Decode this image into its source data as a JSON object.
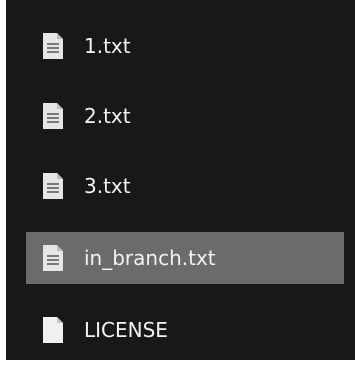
{
  "file_list": {
    "items": [
      {
        "name": "1.txt",
        "icon": "text-file-icon",
        "selected": false
      },
      {
        "name": "2.txt",
        "icon": "text-file-icon",
        "selected": false
      },
      {
        "name": "3.txt",
        "icon": "text-file-icon",
        "selected": false
      },
      {
        "name": "in_branch.txt",
        "icon": "text-file-icon",
        "selected": true
      },
      {
        "name": "LICENSE",
        "icon": "blank-file-icon",
        "selected": false
      }
    ]
  },
  "colors": {
    "panel_background": "#181818",
    "selected_row": "#6b6b6b",
    "text": "#f2f2f2",
    "icon": "#e6e6e6"
  }
}
